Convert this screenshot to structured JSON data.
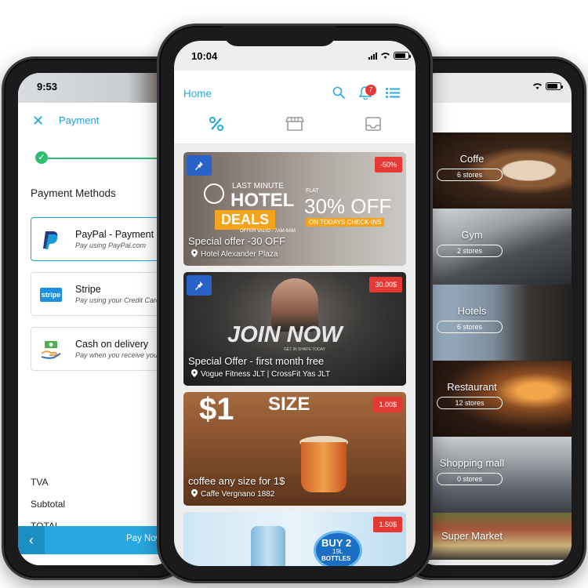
{
  "left_phone": {
    "status_time": "9:53",
    "header": {
      "title": "Payment"
    },
    "section_title": "Payment Methods",
    "methods": [
      {
        "title": "PayPal - Payment",
        "subtitle": "Pay using PayPal.com",
        "icon": "paypal-icon"
      },
      {
        "title": "Stripe",
        "subtitle": "Pay using your Credit Card",
        "icon": "stripe-icon"
      },
      {
        "title": "Cash on delivery",
        "subtitle": "Pay when you receive your order",
        "icon": "cash-hand-icon"
      }
    ],
    "totals": {
      "tva": "TVA",
      "subtotal": "Subtotal",
      "total": "TOTAL"
    },
    "pay_button": "Pay Now"
  },
  "center_phone": {
    "status_time": "10:04",
    "header": {
      "title": "Home",
      "notification_count": "7"
    },
    "tabs": [
      "discount-icon",
      "store-icon",
      "inbox-icon"
    ],
    "offers": [
      {
        "price": "-50%",
        "title": "Special offer -30 OFF",
        "place": "Hotel Alexander Plaza",
        "banner": {
          "line1": "LAST MINUTE",
          "line2": "HOTEL",
          "line3": "DEALS",
          "line4": "OFFER VALID - 7AM-9AM",
          "flat": "FLAT",
          "percent": "30% OFF",
          "sub": "ON TODAYS CHECK-INS"
        }
      },
      {
        "price": "30.00$",
        "title": "Special Offer - first month free",
        "place": "Vogue Fitness JLT | CrossFit Yas JLT",
        "banner": {
          "line1": "JOIN NOW",
          "line2": "GET IN SHAPE TODAY"
        }
      },
      {
        "price": "1.00$",
        "title": "coffee any size for 1$",
        "place": "Caffe Vergnano 1882",
        "banner": {
          "line1": "$1",
          "line2": "SIZE"
        }
      },
      {
        "price": "1.50$",
        "title": "",
        "place": "",
        "banner": {
          "line1": "BUY 2",
          "line2": "19L",
          "line3": "BOTTLES"
        }
      }
    ]
  },
  "right_phone": {
    "categories": [
      {
        "name": "Coffe",
        "count": "6 stores"
      },
      {
        "name": "Gym",
        "count": "2 stores"
      },
      {
        "name": "Hotels",
        "count": "6 stores"
      },
      {
        "name": "Restaurant",
        "count": "12 stores"
      },
      {
        "name": "Shopping mall",
        "count": "0 stores"
      },
      {
        "name": "Super Market",
        "count": ""
      }
    ]
  },
  "colors": {
    "accent": "#27a8e0",
    "badge_red": "#e53935",
    "pin_blue": "#2962c9",
    "progress_green": "#2fbf71"
  }
}
